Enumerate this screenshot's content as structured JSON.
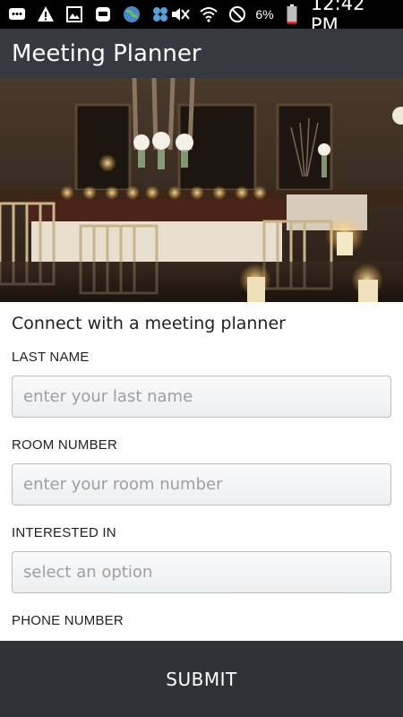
{
  "status_bar": {
    "icons_left": [
      "messenger-icon",
      "warning-icon",
      "gallery-icon",
      "bluetooth-app-icon",
      "globe-icon",
      "apps-icon"
    ],
    "icons_right": [
      "mute-icon",
      "wifi-icon",
      "do-not-disturb-icon",
      "battery-icon"
    ],
    "battery": "6%",
    "time": "12:42 PM"
  },
  "app_bar": {
    "title": "Meeting Planner"
  },
  "form": {
    "intro": "Connect with a meeting planner",
    "last_name": {
      "label": "LAST NAME",
      "placeholder": "enter your last name"
    },
    "room_number": {
      "label": "ROOM NUMBER",
      "placeholder": "enter your room number"
    },
    "interested_in": {
      "label": "INTERESTED IN",
      "placeholder": "select an option"
    },
    "phone_number": {
      "label": "PHONE NUMBER"
    }
  },
  "submit": {
    "label": "SUBMIT"
  }
}
